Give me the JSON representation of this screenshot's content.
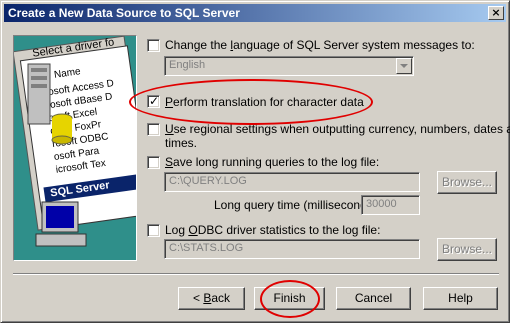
{
  "window": {
    "title": "Create a New Data Source to SQL Server",
    "close_glyph": "×"
  },
  "art": {
    "panel_header": "Select a driver fo",
    "col_name": "Name",
    "drivers": [
      "rosoft Access D",
      "rosoft dBase D",
      "osoft Excel",
      "osoft FoxPr",
      "rosoft ODBC",
      "osoft Para",
      "icrosoft Tex"
    ],
    "selected_driver": "SQL Server"
  },
  "options": {
    "language": {
      "label_pre": "Change the ",
      "label_u": "l",
      "label_post": "anguage of SQL Server system messages to:",
      "checked": false,
      "value": "English"
    },
    "translation": {
      "label_pre": "",
      "label_u": "P",
      "label_post": "erform translation for character data",
      "checked": true
    },
    "regional": {
      "label_line1_pre": "",
      "label_u": "U",
      "label_line1_post": "se regional settings when outputting currency, numbers, dates and",
      "label_line2": "times.",
      "checked": false
    },
    "save_queries": {
      "label_pre": "",
      "label_u": "S",
      "label_post": "ave long running queries to the log file:",
      "checked": false,
      "log_file": "C:\\QUERY.LOG",
      "browse": "Browse...",
      "long_query_label": "Long query time (milliseconds):",
      "long_query_value": "30000"
    },
    "odbc_stats": {
      "label_pre": "Log ",
      "label_u": "O",
      "label_post": "DBC driver statistics to the log file:",
      "checked": false,
      "log_file": "C:\\STATS.LOG",
      "browse": "Browse..."
    }
  },
  "buttons": {
    "back_glyph": "<",
    "back_pre": " ",
    "back_u": "B",
    "back_post": "ack",
    "finish": "Finish",
    "cancel": "Cancel",
    "help": "Help"
  },
  "annotation_color": "#e00000",
  "check_glyph": "✓"
}
